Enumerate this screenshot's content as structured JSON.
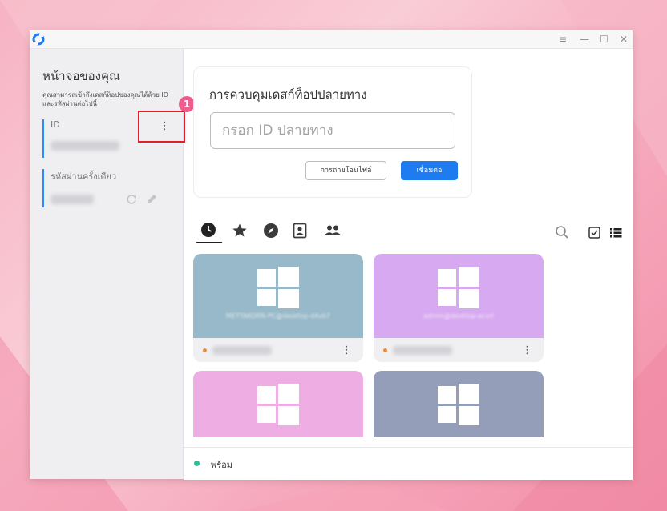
{
  "window": {
    "controls": {
      "menu": "≡",
      "minimize": "—",
      "maximize": "☐",
      "close": "✕"
    }
  },
  "sidebar": {
    "title": "หน้าจอของคุณ",
    "description": "คุณสามารถเข้าถึงเดสก์ท็อปของคุณได้ด้วย ID และรหัสผ่านต่อไปนี้",
    "id_label": "ID",
    "password_label": "รหัสผ่านครั้งเดียว"
  },
  "annotation": {
    "badge": "1"
  },
  "remote": {
    "title": "การควบคุมเดสก์ท็อปปลายทาง",
    "input_placeholder": "กรอก ID ปลายทาง",
    "transfer_button": "การถ่ายโอนไฟล์",
    "connect_button": "เชื่อมต่อ"
  },
  "tabs": [
    {
      "name": "recent",
      "icon": "clock-icon"
    },
    {
      "name": "favorites",
      "icon": "star-icon"
    },
    {
      "name": "discovered",
      "icon": "compass-icon"
    },
    {
      "name": "address-book",
      "icon": "contact-icon"
    },
    {
      "name": "group",
      "icon": "people-icon"
    }
  ],
  "peers": [
    {
      "name": "METTAKORN-PC@desktop-d4vb7",
      "color": "#98b9c9"
    },
    {
      "name": "admin@desktop-ecvrl",
      "color": "#d7a9f1"
    },
    {
      "name": "",
      "color": "#eeaee4"
    },
    {
      "name": "",
      "color": "#949eb9"
    }
  ],
  "status": {
    "text": "พร้อม",
    "color": "#2cbf96"
  },
  "colors": {
    "accent": "#1f7cf0",
    "highlight": "#e01f28",
    "badge": "#ee5d8e"
  }
}
